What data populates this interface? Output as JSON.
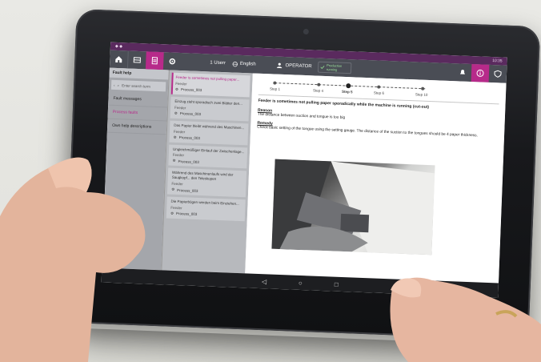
{
  "status": {
    "left": "◆ ◆",
    "right": "10:35"
  },
  "appbar": {
    "language_label": "1 Userr",
    "language": "English",
    "role": "OPERATOR",
    "status_text": "Production running"
  },
  "sidebar": {
    "title": "Fault help",
    "search_placeholder": "Enter search term",
    "items": [
      {
        "label": "Fault messages"
      },
      {
        "label": "Process faults"
      },
      {
        "label": "Own help descriptions"
      }
    ]
  },
  "list": {
    "cards": [
      {
        "title": "Feeder is sometimes not pulling paper...",
        "meta": "Feeder",
        "process": "Process_003"
      },
      {
        "title": "Einzug zieht sporadisch zwei Blätter den...",
        "meta": "Feeder",
        "process": "Process_003"
      },
      {
        "title": "Das Papier bleibt während des Maschinen...",
        "meta": "Feeder",
        "process": "Process_003"
      },
      {
        "title": "Ungleichmäßiger Einlauf der Zwischenlage...",
        "meta": "Feeder",
        "process": "Process_003"
      },
      {
        "title": "Während des Maschinenlaufs wird der Saugkopf... den Teleskopen",
        "meta": "Feeder",
        "process": "Process_003"
      },
      {
        "title": "Die Papierbögen werden beim Einziehen...",
        "meta": "Feeder",
        "process": "Process_003"
      }
    ]
  },
  "detail": {
    "steps": [
      "Step 1",
      "Step 4",
      "Step 5",
      "Step 6",
      "Step 10"
    ],
    "title": "Feeder is sometimes not pulling paper sporadically while the machine is running (cut-out)",
    "reason_label": "Reason",
    "reason_text": "The distance between suction and tongue is too big",
    "remedy_label": "Remedy",
    "remedy_text": "Check basic setting of the tongue using the setting gauge. The distance of the suction to the tongues should be 4 paper thickness."
  },
  "colors": {
    "accent": "#b72a8a",
    "appbar": "#4a4d55"
  }
}
